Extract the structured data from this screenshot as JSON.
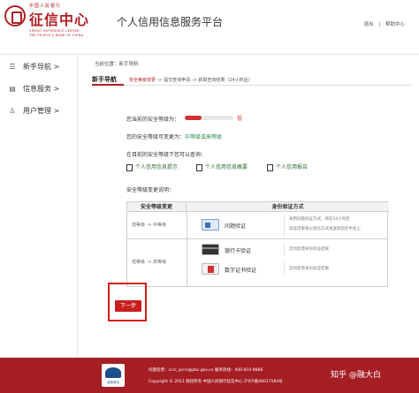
{
  "header": {
    "logo_small": "中国人民银行",
    "logo_main": "征信中心",
    "logo_en1": "CREDIT REFERENCE CENTER",
    "logo_en2": "THE PEOPLE'S BANK OF CHINA",
    "site_title": "个人信用信息服务平台",
    "links": [
      "退出",
      "帮助中心"
    ],
    "link_sep": "|"
  },
  "sidebar": {
    "items": [
      {
        "label": "新手导航 >",
        "icon": "list-icon"
      },
      {
        "label": "信息服务 >",
        "icon": "document-icon"
      },
      {
        "label": "用户管理 >",
        "icon": "user-icon"
      }
    ]
  },
  "breadcrumb": "当前位置：新手导航",
  "stepbar": {
    "title": "新手导航",
    "steps": [
      "安全等级变更",
      " -> 提交查询申请",
      " -> 获取查询结果（24小时后）"
    ]
  },
  "content": {
    "current_level_label": "您当前的安全等级为：",
    "current_level_value": "低",
    "current_level_fraction": 0.35,
    "change_prefix": "您的安全等级可变更为：",
    "change_value": "中等级或高等级",
    "query_label": "在目前的安全等级下您可以查询：",
    "services": [
      "个人信用信息提示",
      "个人信用信息概要",
      "个人信用报告"
    ],
    "explain_label": "安全等级变更说明："
  },
  "table": {
    "headers": [
      "安全等级变更",
      "身份验证方式"
    ],
    "rows": [
      {
        "change": "低等级 -> 中等级",
        "methods": [
          {
            "label": "问题验证",
            "icon": "question-verify-icon",
            "desc": [
              "采用问题验证方式，将在24小时后",
              "验证结果将以短信方式发送到您的手机上"
            ]
          }
        ]
      },
      {
        "change": "低等级 -> 高等级",
        "methods": [
          {
            "label": "银行卡验证",
            "icon": "bank-card-icon",
            "desc": [
              "实时反馈身份验证结果"
            ]
          },
          {
            "label": "数字证书验证",
            "icon": "digital-cert-icon",
            "desc": [
              "实时反馈身份验证结果"
            ]
          }
        ]
      }
    ]
  },
  "next_button": "下一步",
  "footer": {
    "badge_text": "诚信单位",
    "line1": "问题反馈：ccrc_ipcrs@pbc.gov.cn     服务热线：400-810-8866",
    "line2": "Copyright © 2011  版权所有  中国人民银行征信中心  沪ICP备08017584号",
    "watermark": "知乎 @融大白"
  },
  "colors": {
    "brand": "#a51e24",
    "accent_red": "#c81e1e",
    "low_level": "#d72f2f",
    "green": "#2e8b57"
  }
}
